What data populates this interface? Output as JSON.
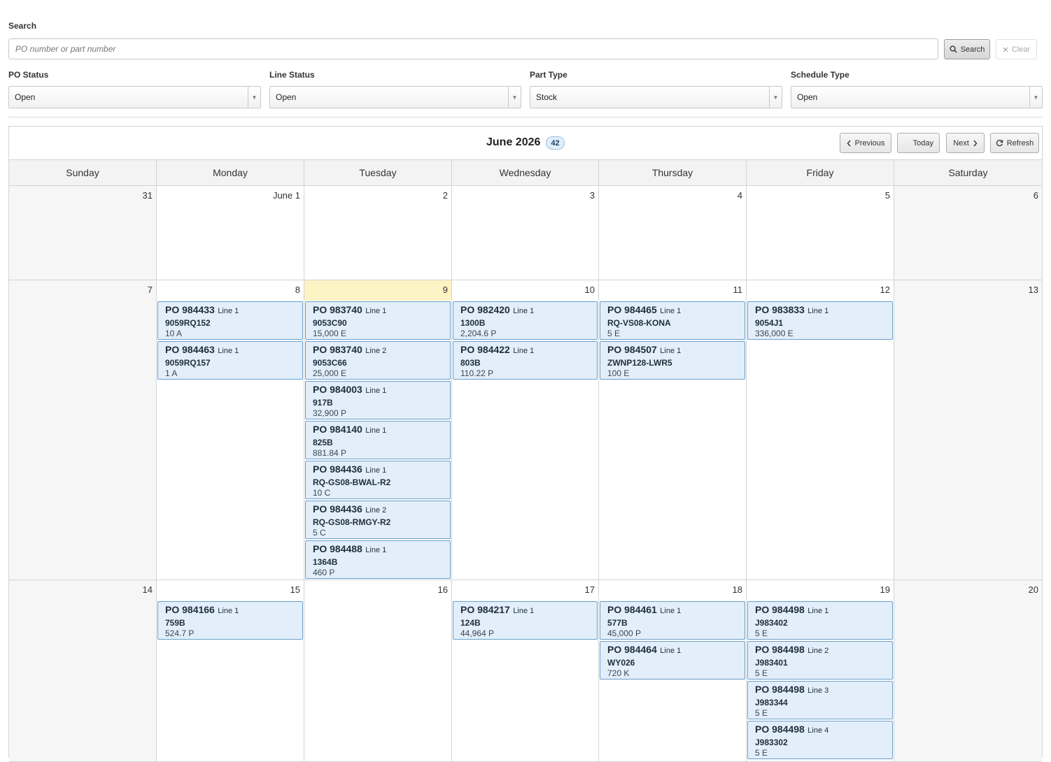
{
  "search": {
    "label": "Search",
    "placeholder": "PO number or part number",
    "value": "",
    "search_button": "Search",
    "clear_button": "Clear"
  },
  "filters": {
    "po_status": {
      "label": "PO Status",
      "value": "Open"
    },
    "line_status": {
      "label": "Line Status",
      "value": "Open"
    },
    "part_type": {
      "label": "Part Type",
      "value": "Stock"
    },
    "schedule_type": {
      "label": "Schedule Type",
      "value": "Open"
    }
  },
  "calendar": {
    "month_title": "June 2026",
    "count": "42",
    "buttons": {
      "previous": "Previous",
      "today": "Today",
      "next": "Next",
      "refresh": "Refresh"
    },
    "days_of_week": [
      "Sunday",
      "Monday",
      "Tuesday",
      "Wednesday",
      "Thursday",
      "Friday",
      "Saturday"
    ],
    "today_date": "9",
    "weeks": [
      {
        "days": [
          {
            "num": "31",
            "events": []
          },
          {
            "num": "June 1",
            "events": []
          },
          {
            "num": "2",
            "events": []
          },
          {
            "num": "3",
            "events": []
          },
          {
            "num": "4",
            "events": []
          },
          {
            "num": "5",
            "events": []
          },
          {
            "num": "6",
            "events": []
          }
        ]
      },
      {
        "days": [
          {
            "num": "7",
            "events": []
          },
          {
            "num": "8",
            "events": [
              {
                "po": "PO 984433",
                "line": "Line 1",
                "part": "9059RQ152",
                "qty": "10 A"
              },
              {
                "po": "PO 984463",
                "line": "Line 1",
                "part": "9059RQ157",
                "qty": "1 A"
              }
            ]
          },
          {
            "num": "9",
            "events": [
              {
                "po": "PO 983740",
                "line": "Line 1",
                "part": "9053C90",
                "qty": "15,000 E"
              },
              {
                "po": "PO 983740",
                "line": "Line 2",
                "part": "9053C66",
                "qty": "25,000 E"
              },
              {
                "po": "PO 984003",
                "line": "Line 1",
                "part": "917B",
                "qty": "32,900 P"
              },
              {
                "po": "PO 984140",
                "line": "Line 1",
                "part": "825B",
                "qty": "881.84 P"
              },
              {
                "po": "PO 984436",
                "line": "Line 1",
                "part": "RQ-GS08-BWAL-R2",
                "qty": "10 C"
              },
              {
                "po": "PO 984436",
                "line": "Line 2",
                "part": "RQ-GS08-RMGY-R2",
                "qty": "5 C"
              },
              {
                "po": "PO 984488",
                "line": "Line 1",
                "part": "1364B",
                "qty": "460 P"
              }
            ]
          },
          {
            "num": "10",
            "events": [
              {
                "po": "PO 982420",
                "line": "Line 1",
                "part": "1300B",
                "qty": "2,204.6 P"
              },
              {
                "po": "PO 984422",
                "line": "Line 1",
                "part": "803B",
                "qty": "110.22 P"
              }
            ]
          },
          {
            "num": "11",
            "events": [
              {
                "po": "PO 984465",
                "line": "Line 1",
                "part": "RQ-VS08-KONA",
                "qty": "5 E"
              },
              {
                "po": "PO 984507",
                "line": "Line 1",
                "part": "ZWNP128-LWR5",
                "qty": "100 E"
              }
            ]
          },
          {
            "num": "12",
            "events": [
              {
                "po": "PO 983833",
                "line": "Line 1",
                "part": "9054J1",
                "qty": "336,000 E"
              }
            ]
          },
          {
            "num": "13",
            "events": []
          }
        ]
      },
      {
        "days": [
          {
            "num": "14",
            "events": []
          },
          {
            "num": "15",
            "events": [
              {
                "po": "PO 984166",
                "line": "Line 1",
                "part": "759B",
                "qty": "524.7 P"
              }
            ]
          },
          {
            "num": "16",
            "events": []
          },
          {
            "num": "17",
            "events": [
              {
                "po": "PO 984217",
                "line": "Line 1",
                "part": "124B",
                "qty": "44,964 P"
              }
            ]
          },
          {
            "num": "18",
            "events": [
              {
                "po": "PO 984461",
                "line": "Line 1",
                "part": "577B",
                "qty": "45,000 P"
              },
              {
                "po": "PO 984464",
                "line": "Line 1",
                "part": "WY026",
                "qty": "720 K"
              }
            ]
          },
          {
            "num": "19",
            "events": [
              {
                "po": "PO 984498",
                "line": "Line 1",
                "part": "J983402",
                "qty": "5 E"
              },
              {
                "po": "PO 984498",
                "line": "Line 2",
                "part": "J983401",
                "qty": "5 E"
              },
              {
                "po": "PO 984498",
                "line": "Line 3",
                "part": "J983344",
                "qty": "5 E"
              },
              {
                "po": "PO 984498",
                "line": "Line 4",
                "part": "J983302",
                "qty": "5 E"
              }
            ]
          },
          {
            "num": "20",
            "events": []
          }
        ]
      }
    ]
  }
}
